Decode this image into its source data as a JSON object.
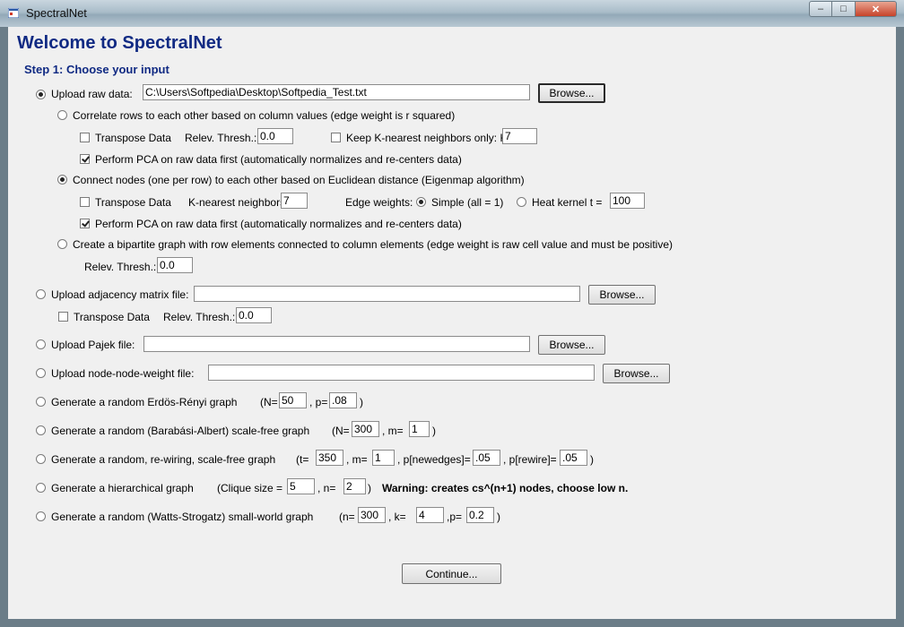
{
  "window": {
    "title": "SpectralNet"
  },
  "header": {
    "title": "Welcome to SpectralNet",
    "step": "Step 1: Choose your input"
  },
  "upload_raw": {
    "label": "Upload raw data:",
    "path": "C:\\Users\\Softpedia\\Desktop\\Softpedia_Test.txt",
    "browse": "Browse...",
    "correlate": {
      "label": "Correlate rows to each other based on column values (edge weight is r squared)",
      "transpose": "Transpose Data",
      "relev_label": "Relev. Thresh.:",
      "relev_value": "0.0",
      "knn_label": "Keep K-nearest neighbors only: K=",
      "knn_value": "7",
      "pca": "Perform PCA on raw data first (automatically normalizes and re-centers data)"
    },
    "connect": {
      "label": "Connect nodes (one per row) to each other based on Euclidean distance (Eigenmap algorithm)",
      "transpose": "Transpose Data",
      "knn_label": "K-nearest neighbors:",
      "knn_value": "7",
      "edge_label": "Edge weights:",
      "simple_label": "Simple (all = 1)",
      "heat_label": "Heat kernel t =",
      "heat_value": "100",
      "pca": "Perform PCA on raw data first (automatically normalizes and re-centers data)"
    },
    "bipartite": {
      "label": "Create a bipartite graph with row elements connected to column elements (edge weight is raw cell value and must be positive)",
      "relev_label": "Relev. Thresh.:",
      "relev_value": "0.0"
    }
  },
  "adjacency": {
    "label": "Upload adjacency matrix file:",
    "path": "",
    "browse": "Browse...",
    "transpose": "Transpose Data",
    "relev_label": "Relev. Thresh.:",
    "relev_value": "0.0"
  },
  "pajek": {
    "label": "Upload Pajek file:",
    "path": "",
    "browse": "Browse..."
  },
  "nnw": {
    "label": "Upload node-node-weight file:",
    "path": "",
    "browse": "Browse..."
  },
  "erdos": {
    "label": "Generate a random Erdös-Rényi graph",
    "n_label": "(N=",
    "n_value": "50",
    "p_label": ", p=",
    "p_value": ".08",
    "close": ")"
  },
  "barabasi": {
    "label": "Generate a random (Barabási-Albert) scale-free graph",
    "n_label": "(N=",
    "n_value": "300",
    "m_label": ", m=",
    "m_value": "1",
    "close": ")"
  },
  "rewiring": {
    "label": "Generate a random, re-wiring, scale-free graph",
    "t_label": "(t=",
    "t_value": "350",
    "m_label": ", m=",
    "m_value": "1",
    "pnew_label": ", p[newedges]=",
    "pnew_value": ".05",
    "prew_label": ", p[rewire]=",
    "prew_value": ".05",
    "close": ")"
  },
  "hierarchical": {
    "label": "Generate a hierarchical graph",
    "c_label": "(Clique size =",
    "c_value": "5",
    "n_label": ", n=",
    "n_value": "2",
    "close": ")",
    "warning": "Warning: creates cs^(n+1) nodes, choose low n."
  },
  "watts": {
    "label": "Generate a random (Watts-Strogatz) small-world graph",
    "n_label": "(n=",
    "n_value": "300",
    "k_label": ", k=",
    "k_value": "4",
    "p_label": ",p=",
    "p_value": "0.2",
    "close": ")"
  },
  "continue": "Continue...",
  "colors": {
    "heading": "#102a83",
    "client_bg": "#f0f0f0"
  }
}
